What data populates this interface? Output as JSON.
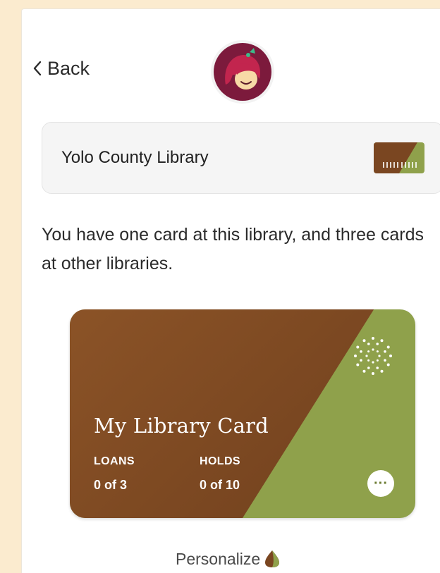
{
  "nav": {
    "back_label": "Back"
  },
  "app": {
    "logo_icon": "libby-logo-icon"
  },
  "library": {
    "name": "Yolo County Library",
    "thumb_icon": "library-card-thumbnail-icon"
  },
  "message": "You have one card at this library, and three cards at other libraries.",
  "card": {
    "title": "My Library Card",
    "loans_label": "LOANS",
    "loans_value": "0 of 3",
    "holds_label": "HOLDS",
    "holds_value": "0 of 10",
    "more_label": "···",
    "colors": {
      "brown": "#7a4621",
      "green": "#8fa14b"
    }
  },
  "personalize": {
    "label": "Personalize",
    "icon": "leaf-icon"
  },
  "colors": {
    "background": "#fbebcf",
    "panel": "#ffffff"
  }
}
